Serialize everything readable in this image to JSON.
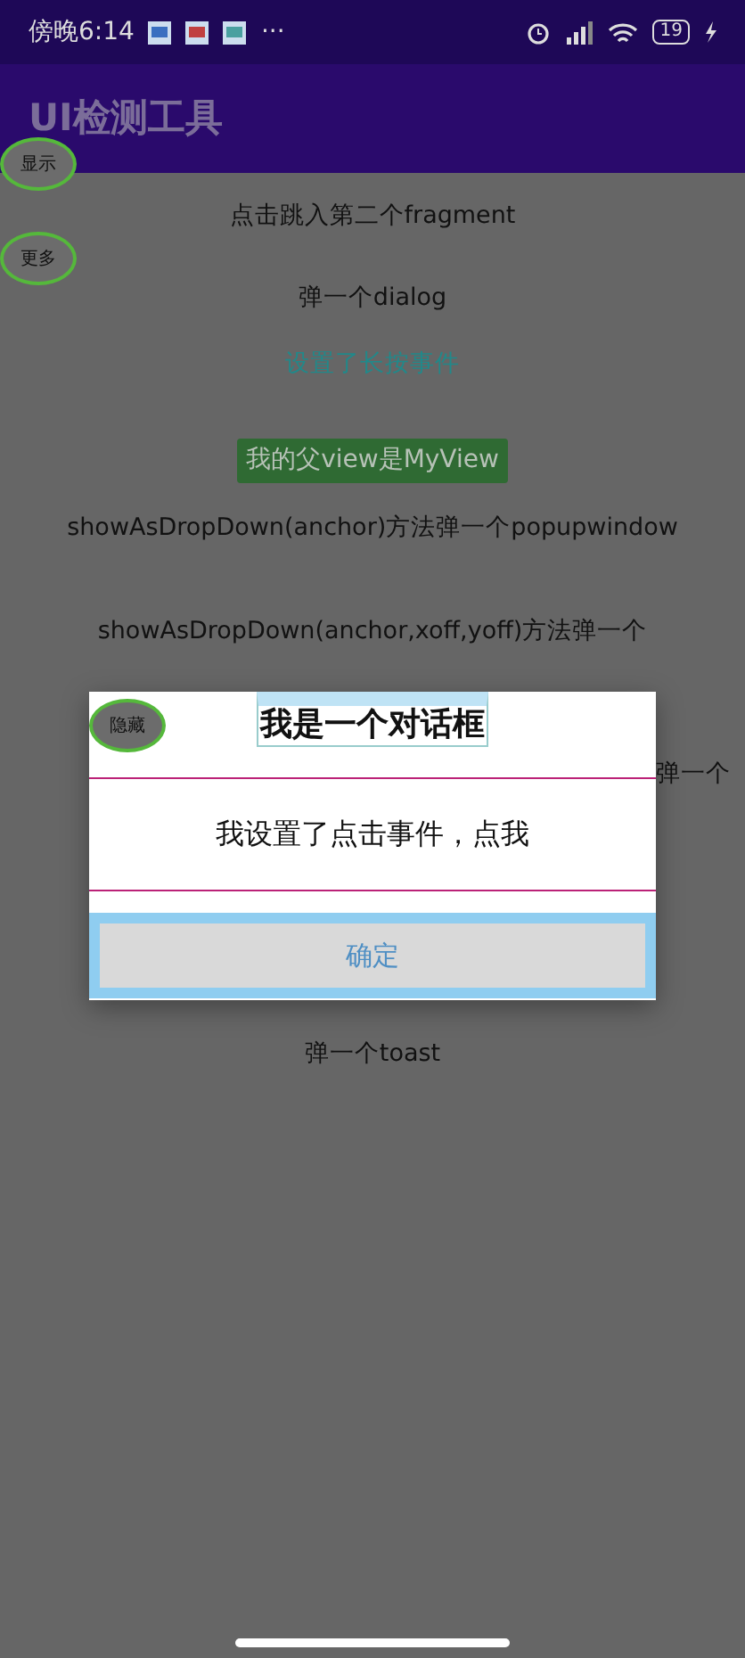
{
  "status_bar": {
    "time": "傍晚6:14",
    "more": "···",
    "battery": "19"
  },
  "app_bar": {
    "title": "UI检测工具"
  },
  "items": [
    {
      "kind": "text",
      "label": "点击跳入第二个fragment"
    },
    {
      "kind": "text",
      "label": "弹一个dialog"
    },
    {
      "kind": "link",
      "label": "设置了长按事件"
    },
    {
      "kind": "green_button",
      "label": "我的父view是MyView"
    },
    {
      "kind": "text",
      "label": "showAsDropDown(anchor)方法弹一个popupwindow"
    },
    {
      "kind": "text",
      "label": "showAsDropDown(anchor,xoff,yoff)方法弹一个"
    },
    {
      "kind": "partial",
      "label": "弹一个"
    },
    {
      "kind": "text",
      "label": "弹一个toast"
    }
  ],
  "dialog": {
    "title": "我是一个对话框",
    "message": "我设置了点击事件，点我",
    "confirm": "确定"
  },
  "bubbles": [
    {
      "label": "显示"
    },
    {
      "label": "更多"
    },
    {
      "label": "隐藏"
    }
  ]
}
